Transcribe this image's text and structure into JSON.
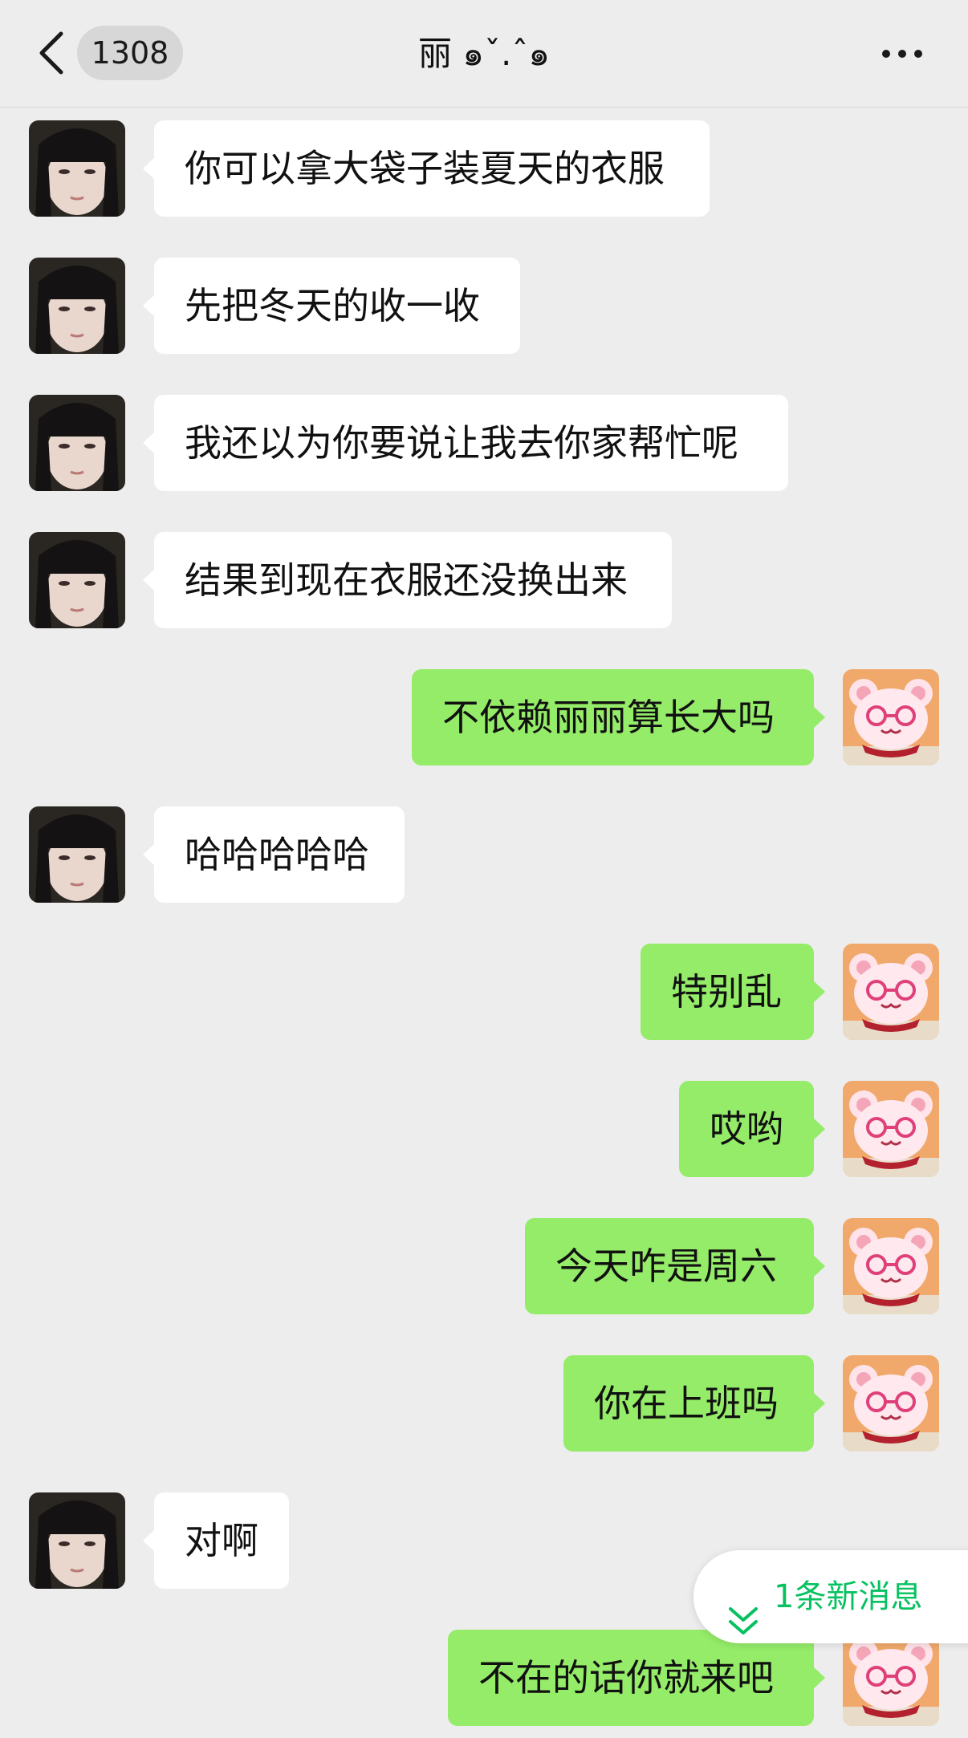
{
  "header": {
    "unread_count": "1308",
    "title": "丽 ๑ˇ.ˆ๑",
    "back_icon": "chevron-left-icon",
    "more_icon": "ellipsis-icon"
  },
  "messages": [
    {
      "side": "in",
      "text": "你可以拿大袋子装夏天的衣服"
    },
    {
      "side": "in",
      "text": "先把冬天的收一收"
    },
    {
      "side": "in",
      "text": "我还以为你要说让我去你家帮忙呢"
    },
    {
      "side": "in",
      "text": "结果到现在衣服还没换出来"
    },
    {
      "side": "out",
      "text": "不依赖丽丽算长大吗"
    },
    {
      "side": "in",
      "text": "哈哈哈哈哈"
    },
    {
      "side": "out",
      "text": "特别乱"
    },
    {
      "side": "out",
      "text": "哎哟"
    },
    {
      "side": "out",
      "text": "今天咋是周六"
    },
    {
      "side": "out",
      "text": "你在上班吗"
    },
    {
      "side": "in",
      "text": "对啊"
    },
    {
      "side": "out",
      "text": "不在的话你就来吧"
    }
  ],
  "new_messages_pill": {
    "label": "1条新消息",
    "icon": "double-chevron-down-icon"
  },
  "colors": {
    "background": "#ededed",
    "incoming_bubble": "#ffffff",
    "outgoing_bubble": "#95ec69",
    "accent_green": "#07c160"
  }
}
